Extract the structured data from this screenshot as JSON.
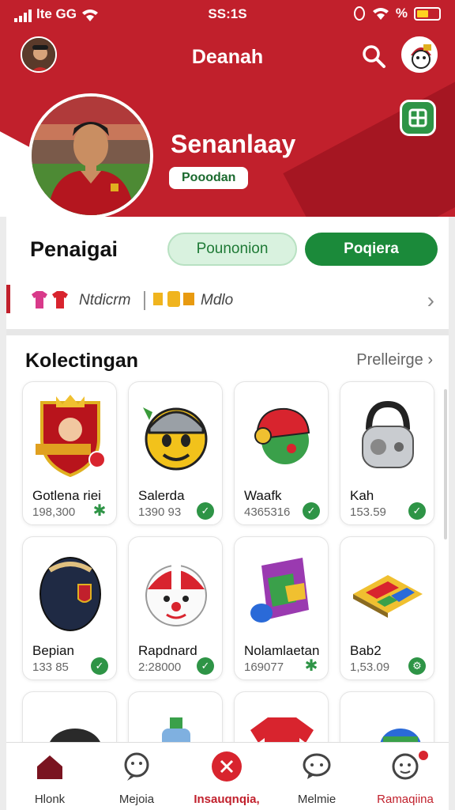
{
  "status_bar": {
    "carrier": "lte GG",
    "time": "SS:1S",
    "battery_label": "%"
  },
  "app_bar": {
    "title": "Deanah"
  },
  "profile": {
    "name": "Senanlaay",
    "tag": "Pooodan"
  },
  "section": {
    "title": "Penaigai",
    "button_secondary": "Pounonion",
    "button_primary": "Poqiera"
  },
  "info_row": {
    "left_text": "Ntdicrm",
    "right_text": "Mdlo"
  },
  "collection": {
    "title": "Kolectingan",
    "link": "Prelleirge",
    "items": [
      {
        "name": "Gotlena riei",
        "price": "198,300",
        "art": "crest-badge",
        "check": "star-check"
      },
      {
        "name": "Salerda",
        "price": "1390 93",
        "art": "yellow-mascot",
        "check": "check"
      },
      {
        "name": "Waafk",
        "price": "4365316",
        "art": "red-helmet",
        "check": "puzzle-check"
      },
      {
        "name": "Kah",
        "price": "153.59",
        "art": "gray-bag",
        "check": "check"
      },
      {
        "name": "Bepian",
        "price": "133 85",
        "art": "rugby-ball",
        "check": "check"
      },
      {
        "name": "Rapdnard",
        "price": "2:28000",
        "art": "clown-helmet",
        "check": "check"
      },
      {
        "name": "Nolamlaetan",
        "price": "169077",
        "art": "purple-box",
        "check": "star-check"
      },
      {
        "name": "Bab2",
        "price": "1,53.09",
        "art": "color-board",
        "check": "gear-check"
      },
      {
        "name": "",
        "price": "",
        "art": "black-ball",
        "check": ""
      },
      {
        "name": "",
        "price": "",
        "art": "blue-bottle",
        "check": ""
      },
      {
        "name": "",
        "price": "",
        "art": "red-jersey",
        "check": ""
      },
      {
        "name": "",
        "price": "",
        "art": "blue-ball",
        "check": ""
      }
    ]
  },
  "bottom_nav": [
    {
      "label": "Hlonk",
      "icon": "home-icon"
    },
    {
      "label": "Mejoia",
      "icon": "chat-icon"
    },
    {
      "label": "Insauqnqia,",
      "icon": "close-circle-icon",
      "active": true
    },
    {
      "label": "Melmie",
      "icon": "message-icon"
    },
    {
      "label": "Ramaqiina",
      "icon": "face-icon"
    }
  ],
  "colors": {
    "primary_red": "#c1202c",
    "primary_green": "#1b8a3a",
    "light_green": "#d9f2df"
  }
}
